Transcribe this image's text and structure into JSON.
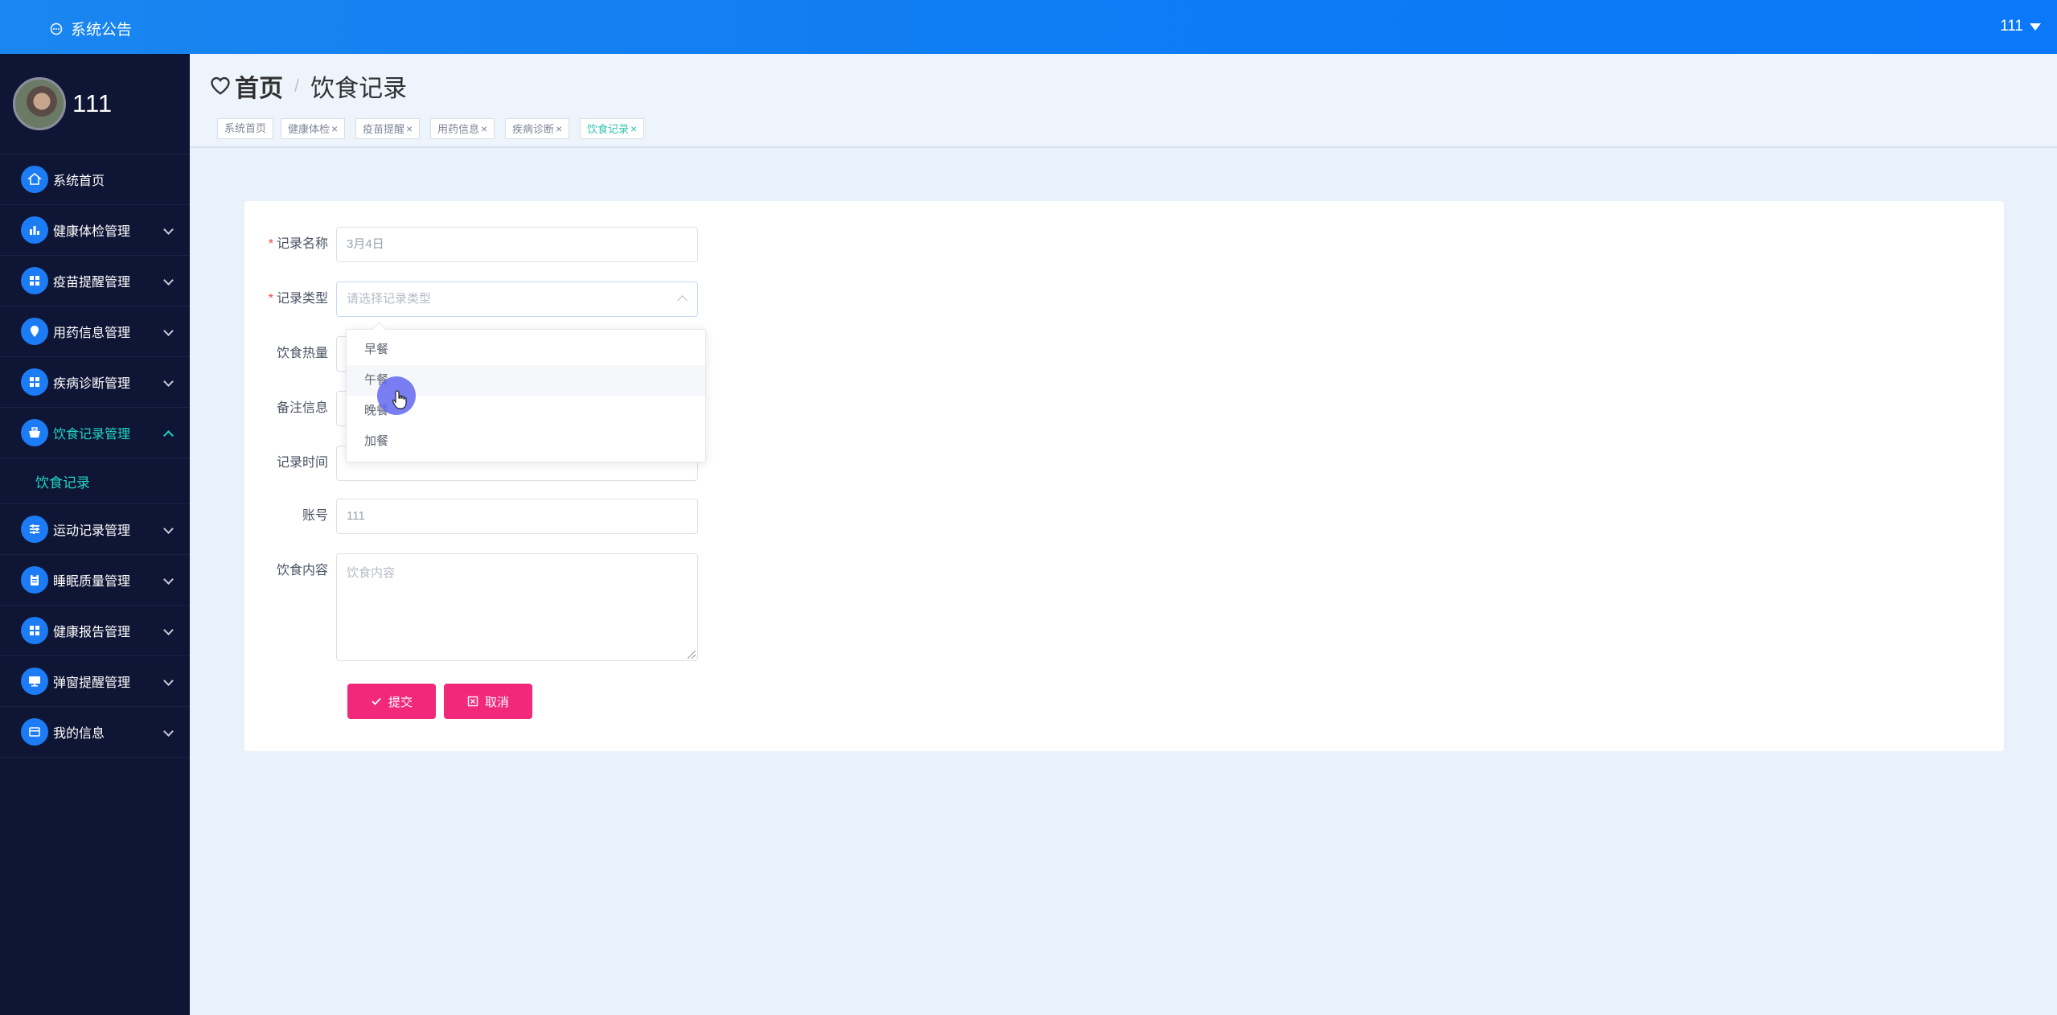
{
  "topbar": {
    "notice_label": "系统公告",
    "user_label": "111"
  },
  "sidebar": {
    "profile_name": "111",
    "items": [
      {
        "label": "系统首页",
        "icon": "home-icon",
        "has_arrow": false
      },
      {
        "label": "健康体检管理",
        "icon": "bar-chart-icon",
        "has_arrow": true
      },
      {
        "label": "疫苗提醒管理",
        "icon": "grid-icon",
        "has_arrow": true
      },
      {
        "label": "用药信息管理",
        "icon": "location-icon",
        "has_arrow": true
      },
      {
        "label": "疾病诊断管理",
        "icon": "grid-icon",
        "has_arrow": true
      },
      {
        "label": "饮食记录管理",
        "icon": "basket-icon",
        "has_arrow": true,
        "expanded": true
      },
      {
        "label": "运动记录管理",
        "icon": "sliders-icon",
        "has_arrow": true
      },
      {
        "label": "睡眠质量管理",
        "icon": "clipboard-icon",
        "has_arrow": true
      },
      {
        "label": "健康报告管理",
        "icon": "grid-icon",
        "has_arrow": true
      },
      {
        "label": "弹窗提醒管理",
        "icon": "monitor-icon",
        "has_arrow": true
      },
      {
        "label": "我的信息",
        "icon": "card-icon",
        "has_arrow": true
      }
    ],
    "submenu": {
      "label": "饮食记录"
    }
  },
  "breadcrumb": {
    "home": "首页",
    "separator": "/",
    "current": "饮食记录"
  },
  "tags": [
    {
      "label": "系统首页",
      "closable": false
    },
    {
      "label": "健康体检",
      "closable": true
    },
    {
      "label": "疫苗提醒",
      "closable": true
    },
    {
      "label": "用药信息",
      "closable": true
    },
    {
      "label": "疾病诊断",
      "closable": true
    },
    {
      "label": "饮食记录",
      "closable": true,
      "active": true
    }
  ],
  "tag_close": "×",
  "form": {
    "record_name": {
      "label": "记录名称",
      "value": "3月4日",
      "required": true
    },
    "record_type": {
      "label": "记录类型",
      "placeholder": "请选择记录类型",
      "required": true
    },
    "calories": {
      "label": "饮食热量"
    },
    "notes": {
      "label": "备注信息"
    },
    "record_time": {
      "label": "记录时间"
    },
    "account": {
      "label": "账号",
      "value": "111"
    },
    "content": {
      "label": "饮食内容",
      "placeholder": "饮食内容"
    },
    "submit_label": "提交",
    "cancel_label": "取消"
  },
  "dropdown": {
    "options": [
      "早餐",
      "午餐",
      "晚餐",
      "加餐"
    ],
    "hovered": "午餐"
  },
  "colors": {
    "topbar": "#1a86f0",
    "sidebar": "#0f1535",
    "accent": "#22d6c6",
    "button": "#f2287b",
    "menu_icon": "#1c7cf5"
  }
}
